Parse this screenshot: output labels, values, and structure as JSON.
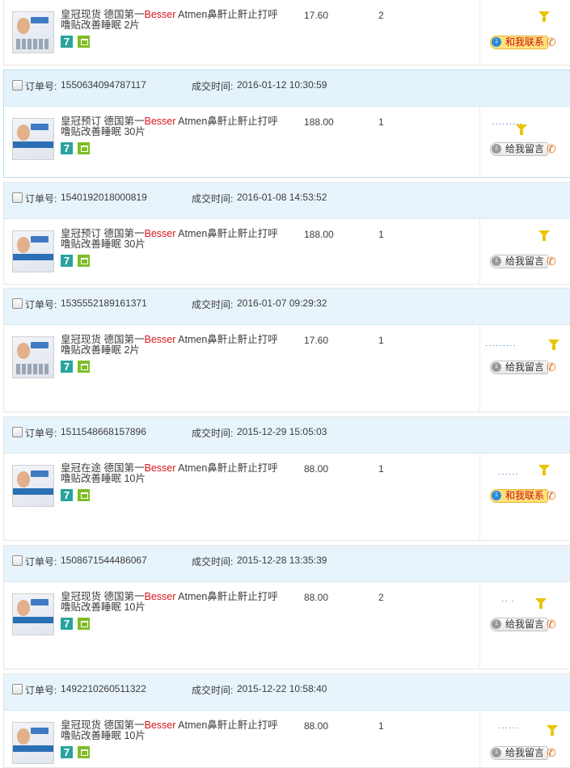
{
  "labels": {
    "order_no": "订单号:",
    "deal_time": "成交时间:"
  },
  "orders": [
    {
      "order_no": "",
      "time": "",
      "title_pre": "皇冠现货 德国第一",
      "title_brand": "Besser",
      "title_post": " Atmen鼻鼾止鼾止打呼噜贴改善睡眠 2片",
      "price": "17.60",
      "qty": "2",
      "seller": "",
      "contact": "和我联系",
      "thumb": "pack"
    },
    {
      "order_no": "1550634094787117",
      "time": "2016-01-12 10:30:59",
      "title_pre": "皇冠预订 德国第一",
      "title_brand": "Besser",
      "title_post": " Atmen鼻鼾止鼾止打呼噜贴改善睡眠 30片",
      "price": "188.00",
      "qty": "1",
      "seller": "·········",
      "contact": "给我留言",
      "thumb": "box"
    },
    {
      "order_no": "1540192018000819",
      "time": "2016-01-08 14:53:52",
      "title_pre": "皇冠预订 德国第一",
      "title_brand": "Besser",
      "title_post": " Atmen鼻鼾止鼾止打呼噜贴改善睡眠 30片",
      "price": "188.00",
      "qty": "1",
      "seller": "",
      "contact": "给我留言",
      "thumb": "box"
    },
    {
      "order_no": "1535552189161371",
      "time": "2016-01-07 09:29:32",
      "title_pre": "皇冠现货 德国第一",
      "title_brand": "Besser",
      "title_post": " Atmen鼻鼾止鼾止打呼噜贴改善睡眠 2片",
      "price": "17.60",
      "qty": "1",
      "seller": "·········",
      "contact": "给我留言",
      "thumb": "pack"
    },
    {
      "order_no": "1511548668157896",
      "time": "2015-12-29 15:05:03",
      "title_pre": "皇冠在途 德国第一",
      "title_brand": "Besser",
      "title_post": " Atmen鼻鼾止鼾止打呼噜贴改善睡眠 10片",
      "price": "88.00",
      "qty": "1",
      "seller": "······",
      "contact": "和我联系",
      "thumb": "box"
    },
    {
      "order_no": "1508671544486067",
      "time": "2015-12-28 13:35:39",
      "title_pre": "皇冠现货 德国第一",
      "title_brand": "Besser",
      "title_post": " Atmen鼻鼾止鼾止打呼噜贴改善睡眠 10片",
      "price": "88.00",
      "qty": "2",
      "seller": "··  ·",
      "contact": "给我留言",
      "thumb": "box"
    },
    {
      "order_no": "1492210260511322",
      "time": "2015-12-22 10:58:40",
      "title_pre": "皇冠现货 德国第一",
      "title_brand": "Besser",
      "title_post": " Atmen鼻鼾止鼾止打呼噜贴改善睡眠 10片",
      "price": "88.00",
      "qty": "1",
      "seller": "······",
      "contact": "给我留言",
      "thumb": "box"
    }
  ]
}
